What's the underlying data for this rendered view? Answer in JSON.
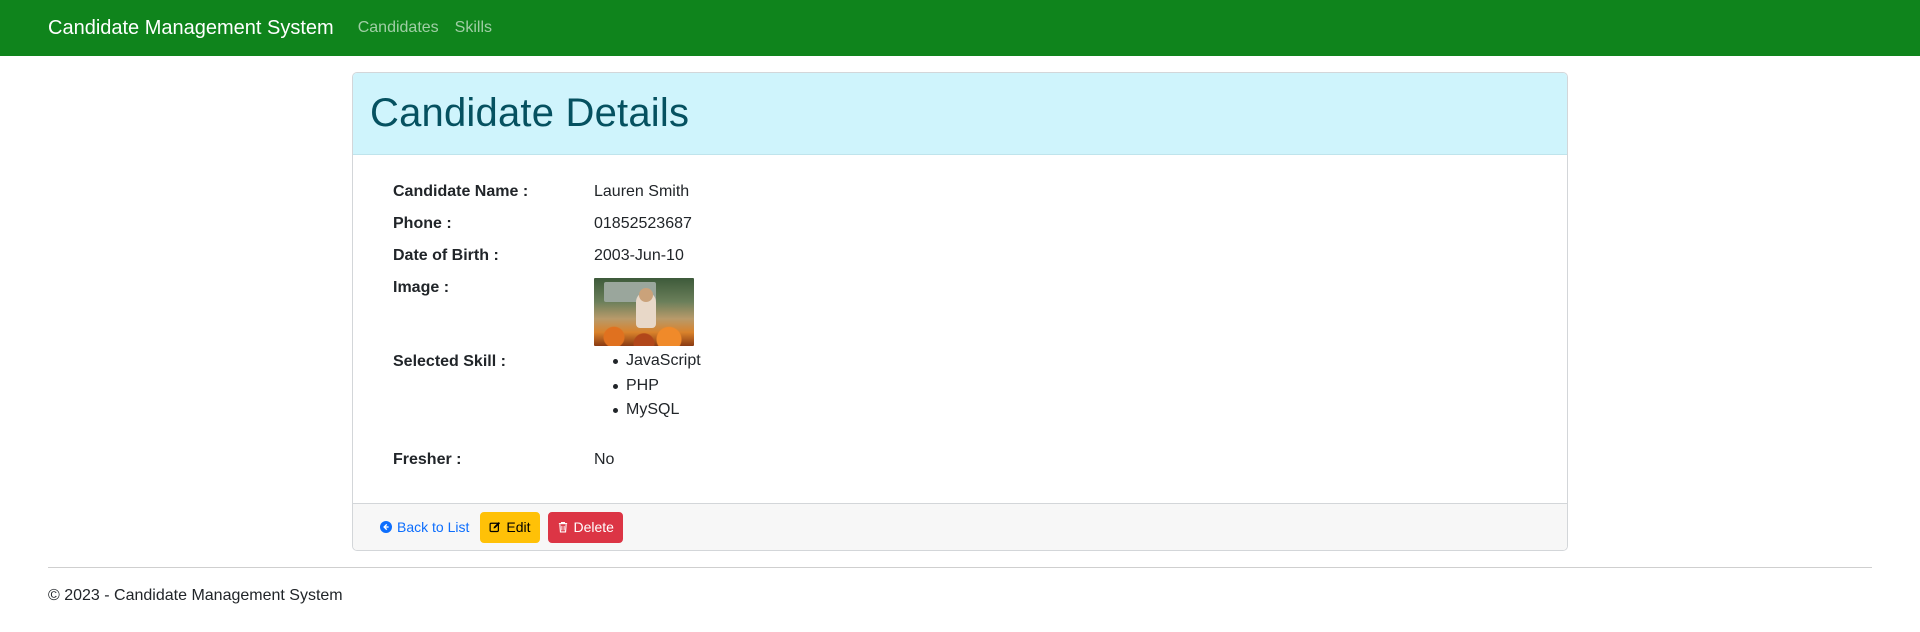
{
  "navbar": {
    "brand": "Candidate Management System",
    "links": [
      "Candidates",
      "Skills"
    ],
    "background": "#0f841c"
  },
  "card": {
    "title": "Candidate Details",
    "header_background": "#cff4fc",
    "fields": {
      "name_label": "Candidate Name :",
      "name_value": "Lauren Smith",
      "phone_label": "Phone :",
      "phone_value": "01852523687",
      "dob_label": "Date of Birth :",
      "dob_value": "2003-Jun-10",
      "image_label": "Image :",
      "skill_label": "Selected Skill :",
      "skills": [
        "JavaScript",
        "PHP",
        "MySQL"
      ],
      "fresher_label": "Fresher :",
      "fresher_value": "No"
    },
    "actions": {
      "back_label": "Back to List",
      "edit_label": "Edit",
      "delete_label": "Delete"
    },
    "icons": {
      "back": "arrow-circle-left-icon",
      "edit": "pencil-square-icon",
      "delete": "trash-icon"
    }
  },
  "footer": {
    "text": "© 2023 - Candidate Management System"
  }
}
